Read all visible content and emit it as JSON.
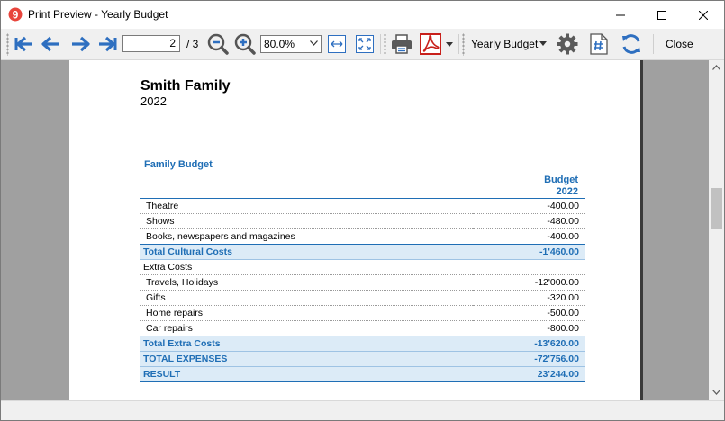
{
  "window": {
    "title": "Print Preview - Yearly Budget"
  },
  "toolbar": {
    "current_page": "2",
    "page_total": "/ 3",
    "zoom": "80.0%",
    "document_select": "Yearly Budget",
    "close_label": "Close"
  },
  "colors": {
    "accent": "#1f6eb5",
    "total_row_bg": "#dcebf7",
    "preview_bg": "#a0a0a0",
    "app_icon": "#e8453c"
  },
  "document": {
    "company": "Smith Family",
    "year": "2022",
    "heading": "Family Budget",
    "column_header_line1": "Budget",
    "column_header_line2": "2022",
    "rows": [
      {
        "label": "Theatre",
        "amount": "-400.00"
      },
      {
        "label": "Shows",
        "amount": "-480.00"
      },
      {
        "label": "Books, newspapers and magazines",
        "amount": "-400.00"
      },
      {
        "label": "Total Cultural Costs",
        "amount": "-1'460.00"
      },
      {
        "label": "Extra Costs",
        "amount": ""
      },
      {
        "label": "Travels, Holidays",
        "amount": "-12'000.00"
      },
      {
        "label": "Gifts",
        "amount": "-320.00"
      },
      {
        "label": "Home repairs",
        "amount": "-500.00"
      },
      {
        "label": "Car repairs",
        "amount": "-800.00"
      },
      {
        "label": "Total Extra Costs",
        "amount": "-13'620.00"
      },
      {
        "label": "TOTAL EXPENSES",
        "amount": "-72'756.00"
      },
      {
        "label": "RESULT",
        "amount": "23'244.00"
      }
    ]
  }
}
